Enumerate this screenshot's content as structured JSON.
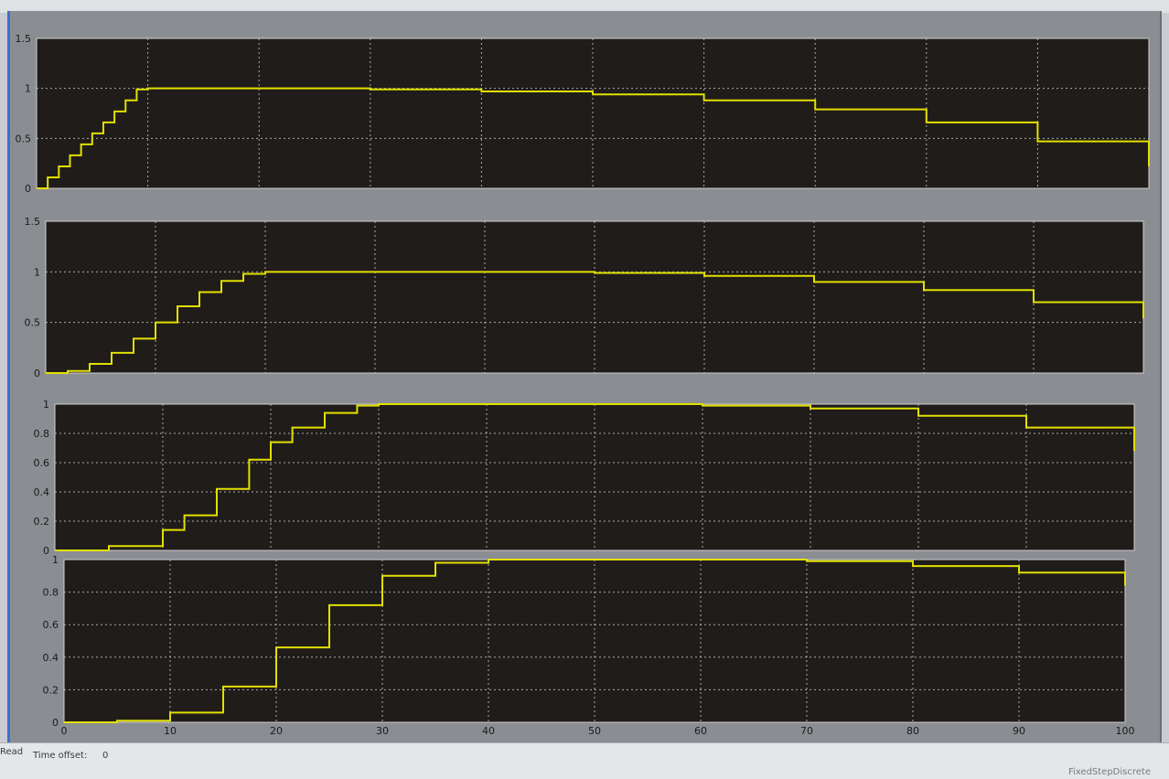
{
  "status": {
    "ready_label": "Read",
    "time_offset_label": "Time offset:",
    "time_offset_value": "0",
    "solver_label": "FixedStepDiscrete"
  },
  "colors": {
    "plot_bg": "#201c1a",
    "signal": "#e2e000",
    "grid": "#d8d8d8",
    "frame": "#8a8d92"
  },
  "chart_data": [
    {
      "type": "line",
      "title": "",
      "xlabel": "",
      "ylabel": "",
      "xlim": [
        0,
        100
      ],
      "ylim": [
        0,
        1.5
      ],
      "yticks": [
        "0",
        "0.5",
        "1",
        "1.5"
      ],
      "xticks": [],
      "grid": true,
      "step": true,
      "series": [
        {
          "x": [
            0,
            1,
            2,
            3,
            4,
            5,
            6,
            7,
            8,
            9,
            10,
            20,
            30,
            40,
            50,
            60,
            70,
            80,
            90,
            100
          ],
          "y": [
            0,
            0.11,
            0.22,
            0.33,
            0.44,
            0.55,
            0.66,
            0.77,
            0.88,
            0.99,
            1.0,
            1.0,
            0.99,
            0.97,
            0.94,
            0.88,
            0.79,
            0.66,
            0.47,
            0.22
          ]
        }
      ]
    },
    {
      "type": "line",
      "title": "",
      "xlabel": "",
      "ylabel": "",
      "xlim": [
        0,
        100
      ],
      "ylim": [
        0,
        1.5
      ],
      "yticks": [
        "0",
        "0.5",
        "1",
        "1.5"
      ],
      "xticks": [],
      "grid": true,
      "step": true,
      "series": [
        {
          "x": [
            0,
            2,
            4,
            6,
            8,
            10,
            12,
            14,
            16,
            18,
            20,
            30,
            40,
            50,
            60,
            70,
            80,
            90,
            100
          ],
          "y": [
            0,
            0.02,
            0.09,
            0.2,
            0.34,
            0.5,
            0.66,
            0.8,
            0.91,
            0.98,
            1.0,
            1.0,
            1.0,
            0.99,
            0.96,
            0.9,
            0.82,
            0.7,
            0.54
          ]
        }
      ]
    },
    {
      "type": "line",
      "title": "",
      "xlabel": "",
      "ylabel": "",
      "xlim": [
        0,
        100
      ],
      "ylim": [
        0,
        1
      ],
      "yticks": [
        "0",
        "0.2",
        "0.4",
        "0.6",
        "0.8",
        "1"
      ],
      "xticks": [],
      "grid": true,
      "step": true,
      "series": [
        {
          "x": [
            0,
            5,
            10,
            12,
            15,
            18,
            20,
            22,
            25,
            28,
            30,
            40,
            50,
            60,
            70,
            80,
            90,
            100
          ],
          "y": [
            0,
            0.03,
            0.14,
            0.24,
            0.42,
            0.62,
            0.74,
            0.84,
            0.94,
            0.99,
            1.0,
            1.0,
            1.0,
            0.99,
            0.97,
            0.92,
            0.84,
            0.68
          ]
        }
      ]
    },
    {
      "type": "line",
      "title": "",
      "xlabel": "",
      "ylabel": "",
      "xlim": [
        0,
        100
      ],
      "ylim": [
        0,
        1
      ],
      "yticks": [
        "0",
        "0.2",
        "0.4",
        "0.6",
        "0.8",
        "1"
      ],
      "xticks": [
        "0",
        "10",
        "20",
        "30",
        "40",
        "50",
        "60",
        "70",
        "80",
        "90",
        "100"
      ],
      "grid": true,
      "step": true,
      "series": [
        {
          "x": [
            0,
            5,
            10,
            15,
            20,
            25,
            30,
            35,
            40,
            50,
            60,
            70,
            80,
            90,
            100
          ],
          "y": [
            0,
            0.01,
            0.06,
            0.22,
            0.46,
            0.72,
            0.9,
            0.98,
            1.0,
            1.0,
            1.0,
            0.99,
            0.96,
            0.92,
            0.84
          ]
        }
      ]
    }
  ]
}
